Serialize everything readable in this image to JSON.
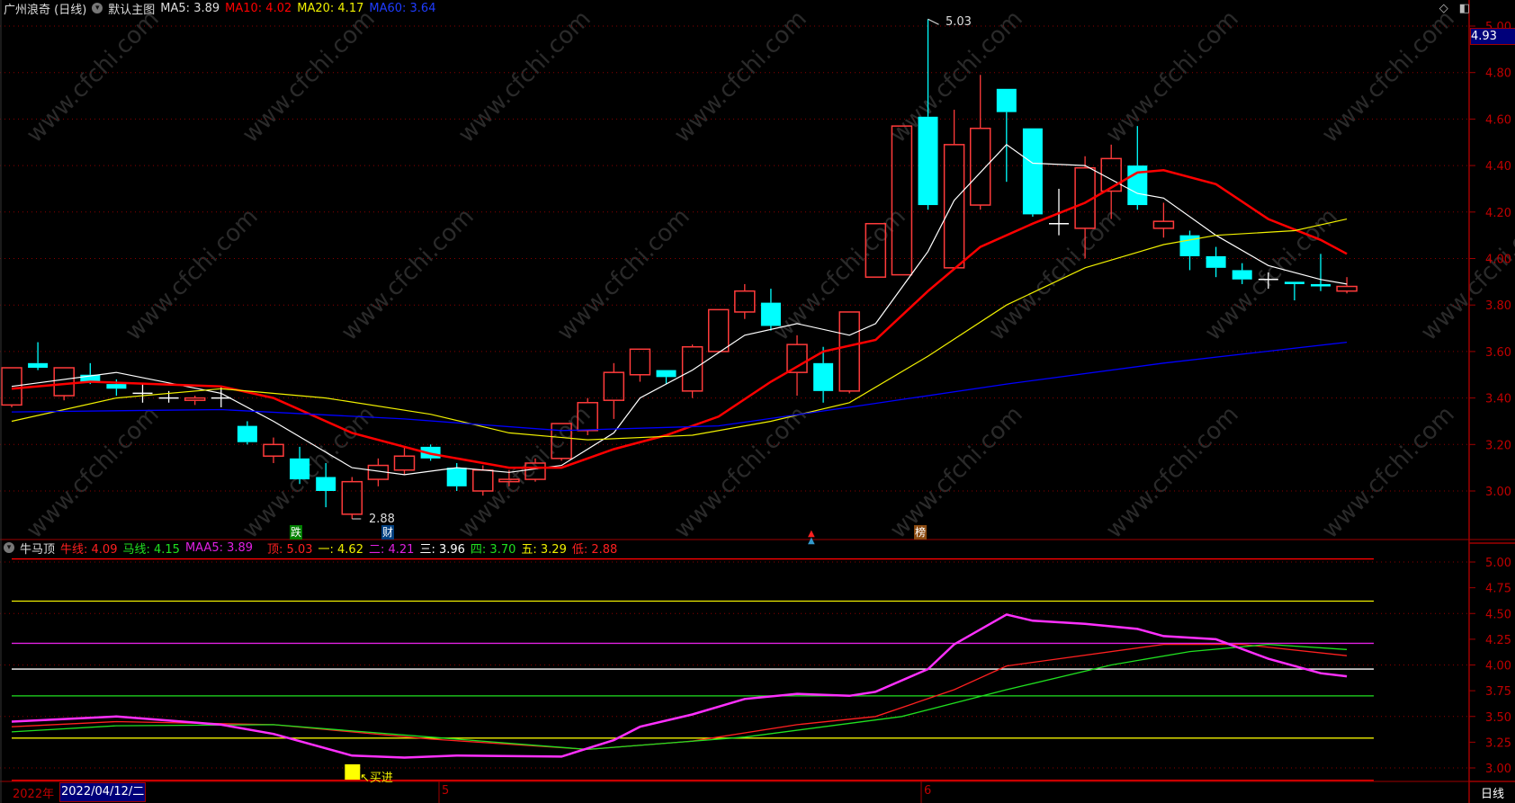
{
  "header": {
    "stock_name": "广州浪奇 (日线)",
    "main_chart_label": "默认主图",
    "ma5": "MA5: 3.89",
    "ma10": "MA10: 4.02",
    "ma20": "MA20: 4.17",
    "ma60": "MA60: 3.64"
  },
  "indicator_header": {
    "name": "牛马顶",
    "items": [
      {
        "text": "牛线: 4.09",
        "color": "#ff2020"
      },
      {
        "text": "马线: 4.15",
        "color": "#20e020"
      },
      {
        "text": "MAA5: 3.89",
        "color": "#e020e0"
      },
      {
        "text": "顶: 5.03",
        "color": "#ff2020"
      },
      {
        "text": "一: 4.62",
        "color": "#f0f000"
      },
      {
        "text": "二: 4.21",
        "color": "#e020e0"
      },
      {
        "text": "三: 3.96",
        "color": "#ffffff"
      },
      {
        "text": "四: 3.70",
        "color": "#20e020"
      },
      {
        "text": "五: 3.29",
        "color": "#f0f000"
      },
      {
        "text": "低: 2.88",
        "color": "#ff2020"
      }
    ]
  },
  "current_price_tag": "4.93",
  "high_label": "5.03",
  "low_label": "2.88",
  "signals": {
    "die": "跌",
    "cai": "财",
    "bang": "榜",
    "buy": "买进"
  },
  "date_axis": {
    "year": "2022年",
    "cursor_date": "2022/04/12/二",
    "months": [
      "5",
      "6"
    ],
    "period": "日线"
  },
  "watermark": "www.cfchi.com",
  "colors": {
    "up": "#ff3b3b",
    "down": "#00ffff",
    "ma5": "#ffffff",
    "ma10": "#ff0000",
    "ma20": "#f0f000",
    "ma60": "#0000ff",
    "axis": "#a00000"
  },
  "chart_data": [
    {
      "type": "candlestick",
      "title": "",
      "y_ticks": [
        "5.00",
        "4.80",
        "4.60",
        "4.40",
        "4.20",
        "4.00",
        "3.80",
        "3.60",
        "3.40",
        "3.20",
        "3.00"
      ],
      "ylim": [
        2.85,
        5.05
      ],
      "grid": true,
      "candles": [
        [
          3.37,
          3.53,
          3.53,
          3.36
        ],
        [
          3.55,
          3.53,
          3.64,
          3.52
        ],
        [
          3.41,
          3.53,
          3.53,
          3.39
        ],
        [
          3.5,
          3.47,
          3.55,
          3.46
        ],
        [
          3.46,
          3.44,
          3.48,
          3.41
        ],
        [
          3.42,
          3.42,
          3.46,
          3.38
        ],
        [
          3.4,
          3.4,
          3.43,
          3.38
        ],
        [
          3.39,
          3.4,
          3.41,
          3.37
        ],
        [
          3.4,
          3.4,
          3.45,
          3.36
        ],
        [
          3.28,
          3.21,
          3.3,
          3.2
        ],
        [
          3.15,
          3.2,
          3.23,
          3.12
        ],
        [
          3.14,
          3.05,
          3.19,
          3.03
        ],
        [
          3.06,
          3.0,
          3.12,
          2.93
        ],
        [
          2.9,
          3.04,
          3.06,
          2.88
        ],
        [
          3.05,
          3.11,
          3.14,
          3.02
        ],
        [
          3.09,
          3.15,
          3.19,
          3.07
        ],
        [
          3.19,
          3.14,
          3.2,
          3.13
        ],
        [
          3.1,
          3.02,
          3.12,
          3.0
        ],
        [
          3.0,
          3.09,
          3.11,
          2.98
        ],
        [
          3.04,
          3.05,
          3.09,
          3.02
        ],
        [
          3.05,
          3.12,
          3.14,
          3.04
        ],
        [
          3.14,
          3.29,
          3.29,
          3.13
        ],
        [
          3.26,
          3.38,
          3.4,
          3.24
        ],
        [
          3.39,
          3.51,
          3.55,
          3.31
        ],
        [
          3.5,
          3.61,
          3.61,
          3.47
        ],
        [
          3.52,
          3.49,
          3.52,
          3.46
        ],
        [
          3.43,
          3.62,
          3.63,
          3.4
        ],
        [
          3.6,
          3.78,
          3.78,
          3.6
        ],
        [
          3.77,
          3.86,
          3.89,
          3.74
        ],
        [
          3.81,
          3.71,
          3.87,
          3.69
        ],
        [
          3.51,
          3.63,
          3.67,
          3.41
        ],
        [
          3.55,
          3.43,
          3.62,
          3.38
        ],
        [
          3.43,
          3.77,
          3.77,
          3.42
        ],
        [
          3.92,
          4.15,
          4.15,
          3.92
        ],
        [
          3.93,
          4.57,
          4.57,
          3.93
        ],
        [
          4.61,
          4.23,
          5.03,
          4.21
        ],
        [
          3.96,
          4.49,
          4.64,
          3.96
        ],
        [
          4.23,
          4.56,
          4.79,
          4.21
        ],
        [
          4.73,
          4.63,
          4.73,
          4.33
        ],
        [
          4.56,
          4.19,
          4.56,
          4.18
        ],
        [
          4.15,
          4.15,
          4.3,
          4.1
        ],
        [
          4.13,
          4.39,
          4.44,
          4.0
        ],
        [
          4.29,
          4.43,
          4.49,
          4.17
        ],
        [
          4.4,
          4.23,
          4.57,
          4.21
        ],
        [
          4.13,
          4.16,
          4.24,
          4.09
        ],
        [
          4.1,
          4.01,
          4.12,
          3.95
        ],
        [
          4.01,
          3.96,
          4.05,
          3.92
        ],
        [
          3.95,
          3.91,
          3.98,
          3.89
        ],
        [
          3.91,
          3.91,
          3.94,
          3.87
        ],
        [
          3.9,
          3.89,
          3.9,
          3.82
        ],
        [
          3.89,
          3.88,
          4.02,
          3.86
        ],
        [
          3.86,
          3.88,
          3.92,
          3.85
        ]
      ],
      "series": [
        {
          "name": "MA5",
          "points": [
            [
              0,
              3.45
            ],
            [
              4,
              3.51
            ],
            [
              8,
              3.42
            ],
            [
              10,
              3.3
            ],
            [
              13,
              3.1
            ],
            [
              15,
              3.07
            ],
            [
              17,
              3.1
            ],
            [
              19,
              3.08
            ],
            [
              21,
              3.11
            ],
            [
              23,
              3.25
            ],
            [
              24,
              3.4
            ],
            [
              26,
              3.52
            ],
            [
              28,
              3.67
            ],
            [
              30,
              3.72
            ],
            [
              32,
              3.67
            ],
            [
              33,
              3.72
            ],
            [
              35,
              4.03
            ],
            [
              36,
              4.25
            ],
            [
              38,
              4.49
            ],
            [
              39,
              4.41
            ],
            [
              41,
              4.4
            ],
            [
              43,
              4.28
            ],
            [
              44,
              4.26
            ],
            [
              46,
              4.1
            ],
            [
              48,
              3.97
            ],
            [
              50,
              3.91
            ],
            [
              51,
              3.89
            ]
          ]
        },
        {
          "name": "MA10",
          "points": [
            [
              0,
              3.44
            ],
            [
              3,
              3.47
            ],
            [
              8,
              3.45
            ],
            [
              10,
              3.4
            ],
            [
              13,
              3.25
            ],
            [
              16,
              3.16
            ],
            [
              19,
              3.1
            ],
            [
              21,
              3.1
            ],
            [
              23,
              3.18
            ],
            [
              25,
              3.24
            ],
            [
              27,
              3.32
            ],
            [
              29,
              3.47
            ],
            [
              31,
              3.6
            ],
            [
              33,
              3.65
            ],
            [
              35,
              3.86
            ],
            [
              37,
              4.05
            ],
            [
              39,
              4.15
            ],
            [
              41,
              4.24
            ],
            [
              43,
              4.37
            ],
            [
              44,
              4.38
            ],
            [
              46,
              4.32
            ],
            [
              48,
              4.17
            ],
            [
              50,
              4.08
            ],
            [
              51,
              4.02
            ]
          ]
        },
        {
          "name": "MA20",
          "points": [
            [
              0,
              3.3
            ],
            [
              4,
              3.4
            ],
            [
              8,
              3.44
            ],
            [
              12,
              3.4
            ],
            [
              16,
              3.33
            ],
            [
              19,
              3.25
            ],
            [
              22,
              3.22
            ],
            [
              26,
              3.24
            ],
            [
              29,
              3.3
            ],
            [
              32,
              3.38
            ],
            [
              35,
              3.58
            ],
            [
              38,
              3.8
            ],
            [
              41,
              3.96
            ],
            [
              44,
              4.06
            ],
            [
              46,
              4.1
            ],
            [
              49,
              4.12
            ],
            [
              51,
              4.17
            ]
          ]
        },
        {
          "name": "MA60",
          "points": [
            [
              0,
              3.34
            ],
            [
              8,
              3.35
            ],
            [
              15,
              3.31
            ],
            [
              21,
              3.26
            ],
            [
              27,
              3.28
            ],
            [
              32,
              3.36
            ],
            [
              38,
              3.46
            ],
            [
              44,
              3.55
            ],
            [
              51,
              3.64
            ]
          ]
        }
      ]
    },
    {
      "type": "line",
      "title": "",
      "y_ticks": [
        "5.00",
        "4.75",
        "4.50",
        "4.25",
        "4.00",
        "3.75",
        "3.50",
        "3.25",
        "3.00"
      ],
      "ylim": [
        2.85,
        5.08
      ],
      "levels": [
        {
          "name": "顶",
          "value": 5.03,
          "color": "#ff0000"
        },
        {
          "name": "一",
          "value": 4.62,
          "color": "#f0f000"
        },
        {
          "name": "二",
          "value": 4.21,
          "color": "#e020e0"
        },
        {
          "name": "三",
          "value": 3.96,
          "color": "#ffffff"
        },
        {
          "name": "四",
          "value": 3.7,
          "color": "#20e020"
        },
        {
          "name": "五",
          "value": 3.29,
          "color": "#f0f000"
        },
        {
          "name": "低",
          "value": 2.88,
          "color": "#ff0000"
        }
      ],
      "series": [
        {
          "name": "牛线",
          "color": "#ff2020",
          "points": [
            [
              0,
              3.4
            ],
            [
              4,
              3.45
            ],
            [
              10,
              3.42
            ],
            [
              16,
              3.28
            ],
            [
              22,
              3.18
            ],
            [
              26,
              3.26
            ],
            [
              30,
              3.42
            ],
            [
              33,
              3.5
            ],
            [
              36,
              3.76
            ],
            [
              38,
              3.99
            ],
            [
              40,
              4.06
            ],
            [
              44,
              4.2
            ],
            [
              47,
              4.2
            ],
            [
              51,
              4.09
            ]
          ]
        },
        {
          "name": "马线",
          "color": "#20e020",
          "points": [
            [
              0,
              3.35
            ],
            [
              4,
              3.41
            ],
            [
              10,
              3.42
            ],
            [
              16,
              3.3
            ],
            [
              22,
              3.18
            ],
            [
              28,
              3.3
            ],
            [
              34,
              3.5
            ],
            [
              38,
              3.76
            ],
            [
              42,
              4.0
            ],
            [
              45,
              4.13
            ],
            [
              48,
              4.2
            ],
            [
              51,
              4.15
            ]
          ]
        },
        {
          "name": "MAA5",
          "color": "#ff30ff",
          "points": [
            [
              0,
              3.45
            ],
            [
              4,
              3.5
            ],
            [
              8,
              3.42
            ],
            [
              10,
              3.33
            ],
            [
              13,
              3.12
            ],
            [
              15,
              3.1
            ],
            [
              17,
              3.12
            ],
            [
              21,
              3.11
            ],
            [
              23,
              3.27
            ],
            [
              24,
              3.4
            ],
            [
              26,
              3.52
            ],
            [
              28,
              3.67
            ],
            [
              30,
              3.72
            ],
            [
              32,
              3.7
            ],
            [
              33,
              3.74
            ],
            [
              35,
              3.96
            ],
            [
              36,
              4.2
            ],
            [
              38,
              4.49
            ],
            [
              39,
              4.43
            ],
            [
              41,
              4.4
            ],
            [
              43,
              4.35
            ],
            [
              44,
              4.28
            ],
            [
              46,
              4.25
            ],
            [
              48,
              4.06
            ],
            [
              50,
              3.92
            ],
            [
              51,
              3.89
            ]
          ]
        }
      ],
      "buy_signal_index": 13
    }
  ]
}
